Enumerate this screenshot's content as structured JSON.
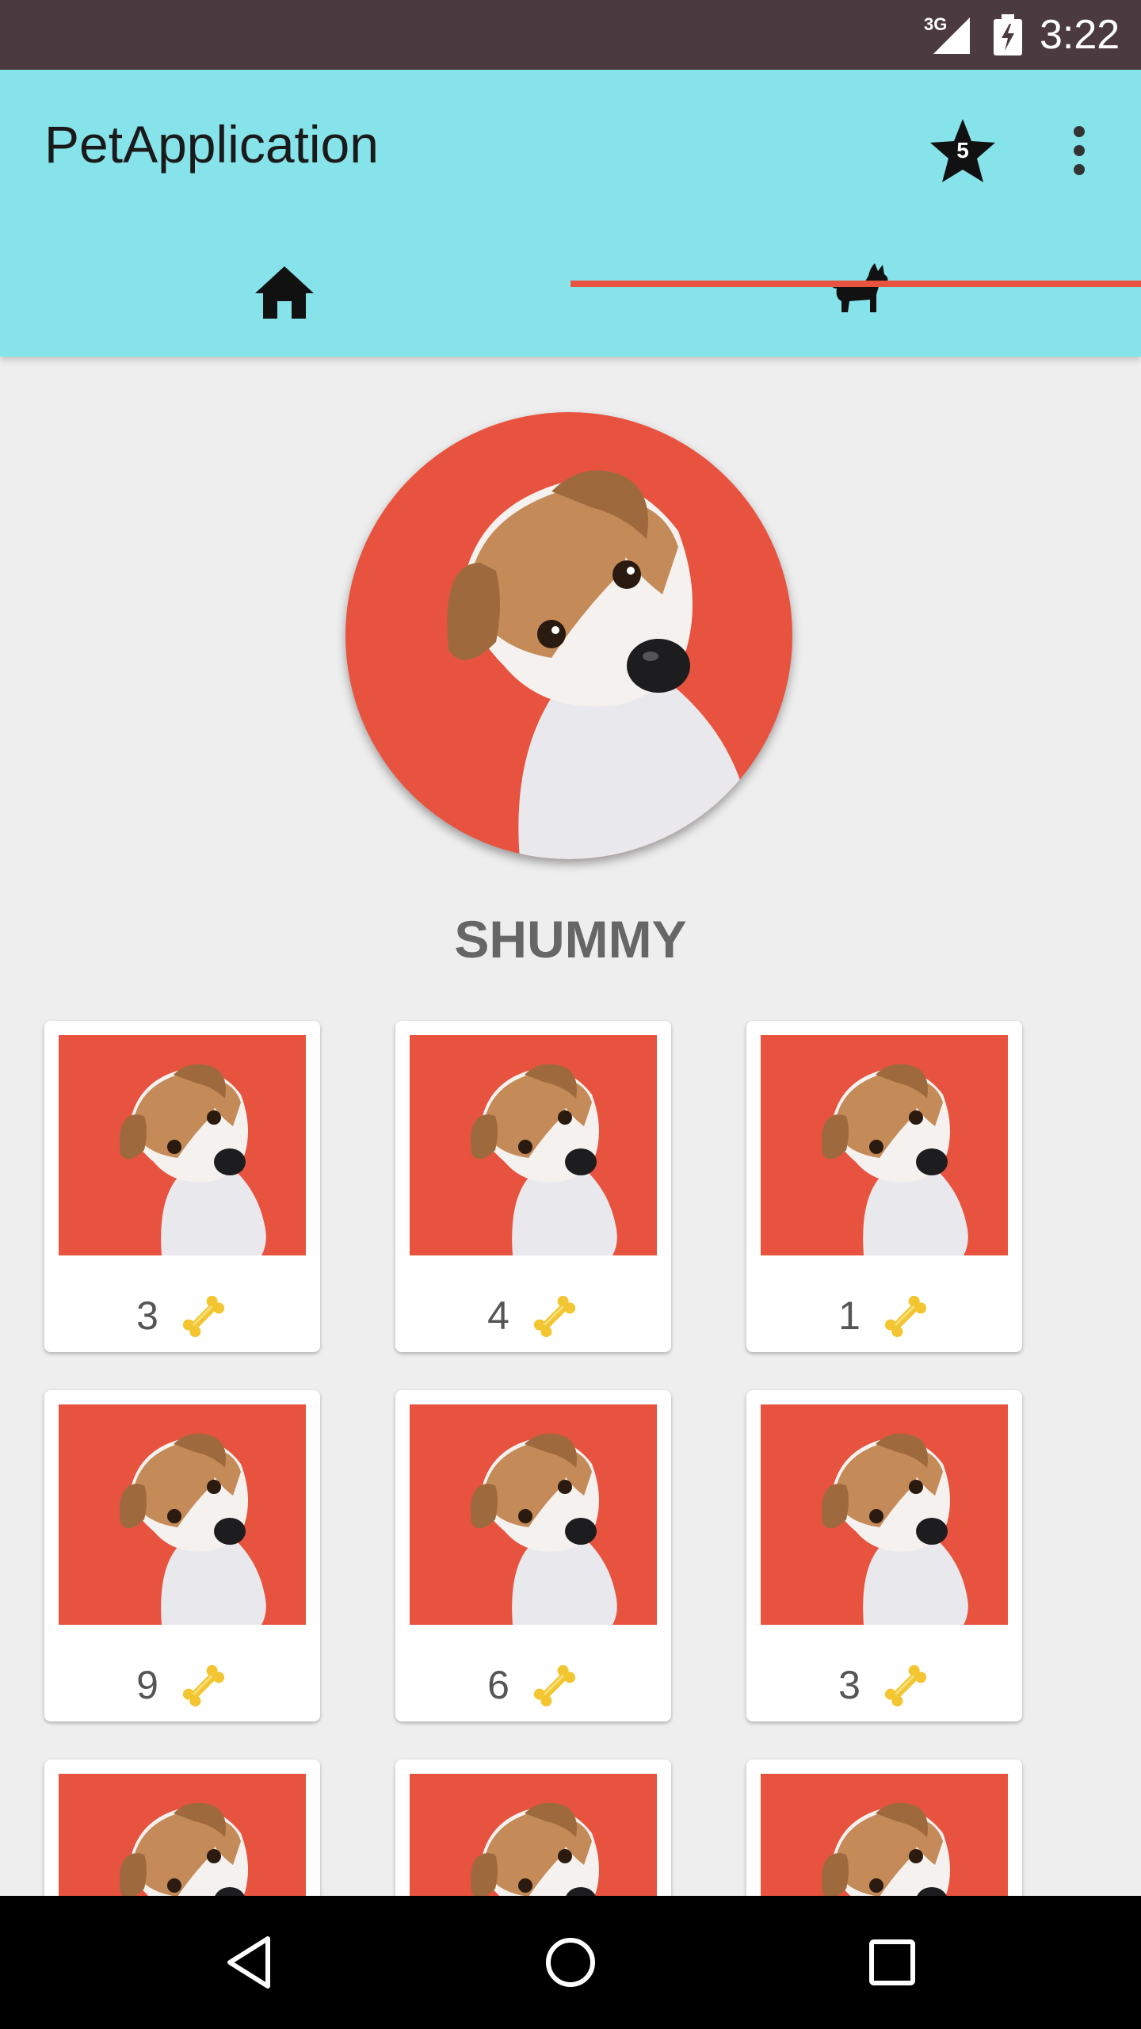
{
  "status_bar": {
    "network": "3G",
    "time": "3:22"
  },
  "app_bar": {
    "title": "PetApplication",
    "star_badge_count": "5",
    "accent_color": "#86e3ea",
    "indicator_color": "#e8533f"
  },
  "tabs": [
    {
      "icon": "home-icon",
      "selected": false
    },
    {
      "icon": "dog-icon",
      "selected": true
    }
  ],
  "profile": {
    "name": "SHUMMY",
    "avatar_bg": "#e8533f"
  },
  "gallery": {
    "items": [
      {
        "bones": "3"
      },
      {
        "bones": "4"
      },
      {
        "bones": "1"
      },
      {
        "bones": "9"
      },
      {
        "bones": "6"
      },
      {
        "bones": "3"
      },
      {
        "bones": ""
      },
      {
        "bones": ""
      },
      {
        "bones": ""
      }
    ]
  },
  "nav_bar": {
    "buttons": [
      "back-icon",
      "home-icon",
      "recents-icon"
    ]
  }
}
